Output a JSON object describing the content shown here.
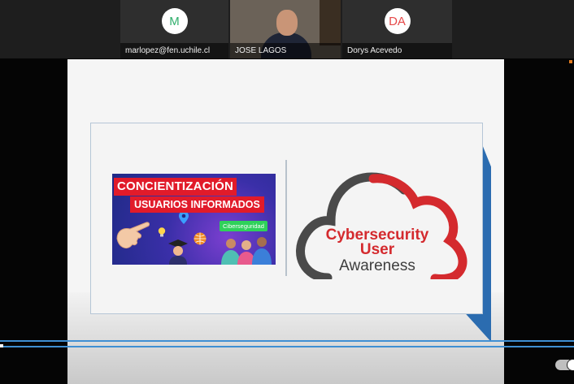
{
  "participants": [
    {
      "initials": "M",
      "name": "marlopez@fen.uchile.cl"
    },
    {
      "initials": "",
      "name": "JOSE LAGOS"
    },
    {
      "initials": "DA",
      "name": "Dorys Acevedo"
    }
  ],
  "slide": {
    "banner": {
      "title": "CONCIENTIZACIÓN",
      "subtitle": "USUARIOS INFORMADOS",
      "tag": "Ciberseguridad"
    },
    "logo": {
      "line1": "Cybersecurity",
      "line2": "User",
      "line3": "Awareness"
    }
  },
  "colors": {
    "accent_red": "#d42a2e",
    "banner_red": "#e11b2a",
    "slide_blue": "#2b6cb0",
    "timeline_blue": "#3f8fd3"
  }
}
